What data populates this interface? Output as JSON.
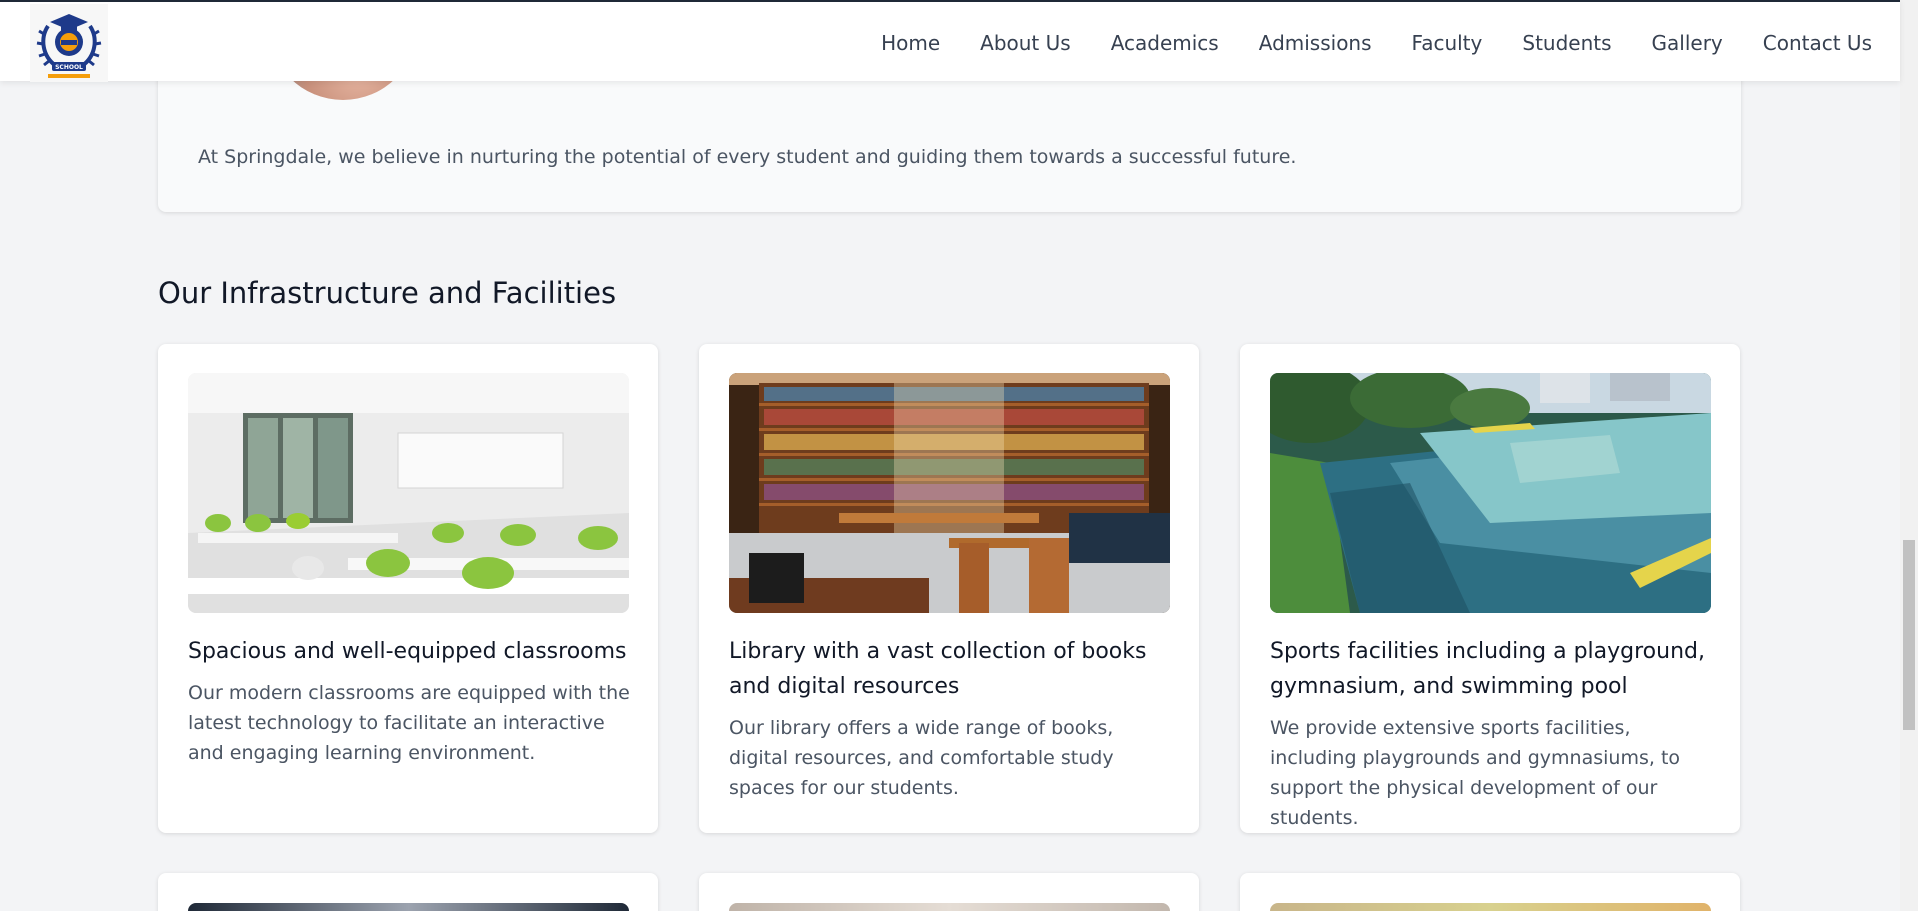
{
  "nav": {
    "items": [
      "Home",
      "About Us",
      "Academics",
      "Admissions",
      "Faculty",
      "Students",
      "Gallery",
      "Contact Us"
    ],
    "logo_text": "SCHOOL"
  },
  "quote": {
    "text": "At Springdale, we believe in nurturing the potential of every student and guiding them towards a successful future."
  },
  "facilities": {
    "title": "Our Infrastructure and Facilities",
    "cards": [
      {
        "title": "Spacious and well-equipped classrooms",
        "description": "Our modern classrooms are equipped with the latest technology to facilitate an interactive and engaging learning environment."
      },
      {
        "title": "Library with a vast collection of books and digital resources",
        "description": "Our library offers a wide range of books, digital resources, and comfortable study spaces for our students."
      },
      {
        "title": "Sports facilities including a playground, gymnasium, and swimming pool",
        "description": "We provide extensive sports facilities, including playgrounds and gymnasiums, to support the physical development of our students."
      }
    ]
  },
  "colors": {
    "background": "#f3f4f6",
    "card": "#ffffff",
    "text": "#111827",
    "muted": "#4b5563",
    "logo_blue": "#1e3a8a",
    "logo_orange": "#f59e0b"
  }
}
